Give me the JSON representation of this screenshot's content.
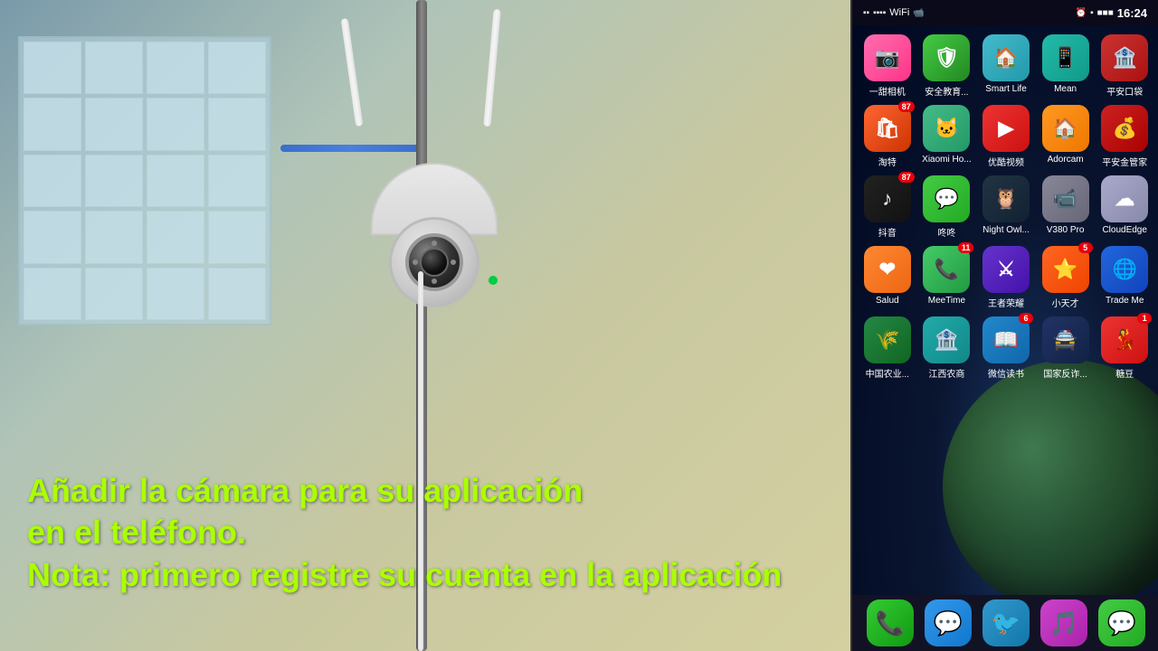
{
  "video": {
    "overlay_line1": "Añadir la cámara para su aplicación",
    "overlay_line2": "en el teléfono.",
    "overlay_line3": "Nota: primero registre su cuenta en la aplicación"
  },
  "phone": {
    "status_bar": {
      "time": "16:24",
      "signal": "▪▪▪▪",
      "wifi": "WiFi",
      "battery": "Battery"
    },
    "apps": [
      {
        "id": "yitian",
        "label": "一甜相机",
        "color": "icon-pink",
        "icon": "📷",
        "badge": ""
      },
      {
        "id": "anquan",
        "label": "安全教育...",
        "color": "icon-green",
        "icon": "🛡",
        "badge": ""
      },
      {
        "id": "smartlife",
        "label": "Smart Life",
        "color": "icon-teal",
        "icon": "🏠",
        "badge": ""
      },
      {
        "id": "mean",
        "label": "Mean",
        "color": "icon-blue-green",
        "icon": "📱",
        "badge": ""
      },
      {
        "id": "pingan",
        "label": "平安口袋",
        "color": "icon-red-bank",
        "icon": "🏦",
        "badge": ""
      },
      {
        "id": "taote",
        "label": "淘特",
        "color": "icon-orange-red",
        "icon": "🛍",
        "badge": "87"
      },
      {
        "id": "xiaomiho",
        "label": "Xiaomi Ho...",
        "color": "icon-cat-green",
        "icon": "🐱",
        "badge": ""
      },
      {
        "id": "youku",
        "label": "优酷视频",
        "color": "icon-red-youku",
        "icon": "▶",
        "badge": ""
      },
      {
        "id": "adorcam",
        "label": "Adorcam",
        "color": "icon-orange-home",
        "icon": "🏠",
        "badge": ""
      },
      {
        "id": "pingan2",
        "label": "平安金管家",
        "color": "icon-red-ping",
        "icon": "💰",
        "badge": ""
      },
      {
        "id": "douyin",
        "label": "抖音",
        "color": "icon-black-tiktok",
        "icon": "♪",
        "badge": "87"
      },
      {
        "id": "咚咚",
        "label": "咚咚",
        "color": "icon-green-chat",
        "icon": "💬",
        "badge": ""
      },
      {
        "id": "nightowl",
        "label": "Night Owl...",
        "color": "icon-dark-nightowl",
        "icon": "🦉",
        "badge": ""
      },
      {
        "id": "v380pro",
        "label": "V380 Pro",
        "color": "icon-gray-v380",
        "icon": "📹",
        "badge": ""
      },
      {
        "id": "cloudedge",
        "label": "CloudEdge",
        "color": "icon-gray-cloud",
        "icon": "☁",
        "badge": ""
      },
      {
        "id": "salud",
        "label": "Salud",
        "color": "icon-orange-heart",
        "icon": "❤",
        "badge": ""
      },
      {
        "id": "meetime",
        "label": "MeeTime",
        "color": "icon-green-meet",
        "icon": "📞",
        "badge": "11"
      },
      {
        "id": "wangzhe",
        "label": "王者荣耀",
        "color": "icon-purple-game",
        "icon": "⚔",
        "badge": ""
      },
      {
        "id": "xiaotian",
        "label": "小天才",
        "color": "icon-orange-xiaotian",
        "icon": "⭐",
        "badge": "5"
      },
      {
        "id": "trademe",
        "label": "Trade Me",
        "color": "icon-blue-trade",
        "icon": "🌐",
        "badge": ""
      },
      {
        "id": "zhongguo",
        "label": "中国农业...",
        "color": "icon-green-bank",
        "icon": "🌾",
        "badge": ""
      },
      {
        "id": "jiangxi",
        "label": "江西农商",
        "color": "icon-teal-jiangxi",
        "icon": "🏦",
        "badge": ""
      },
      {
        "id": "weixin",
        "label": "微信读书",
        "color": "icon-blue-wx",
        "icon": "📖",
        "badge": "6"
      },
      {
        "id": "guojia",
        "label": "国家反诈...",
        "color": "icon-dark-police",
        "icon": "🚔",
        "badge": ""
      },
      {
        "id": "yangdou",
        "label": "糖豆",
        "color": "icon-red-momo",
        "icon": "💃",
        "badge": "1"
      }
    ],
    "dock": [
      {
        "id": "phone",
        "color": "icon-green-phone",
        "icon": "📞"
      },
      {
        "id": "messages",
        "color": "icon-blue-msg",
        "icon": "💬"
      },
      {
        "id": "browser",
        "color": "icon-blue-bird",
        "icon": "🐦"
      },
      {
        "id": "music",
        "color": "icon-purple-music",
        "icon": "🎵"
      },
      {
        "id": "wechat",
        "color": "icon-green-wechat",
        "icon": "💬"
      }
    ]
  }
}
